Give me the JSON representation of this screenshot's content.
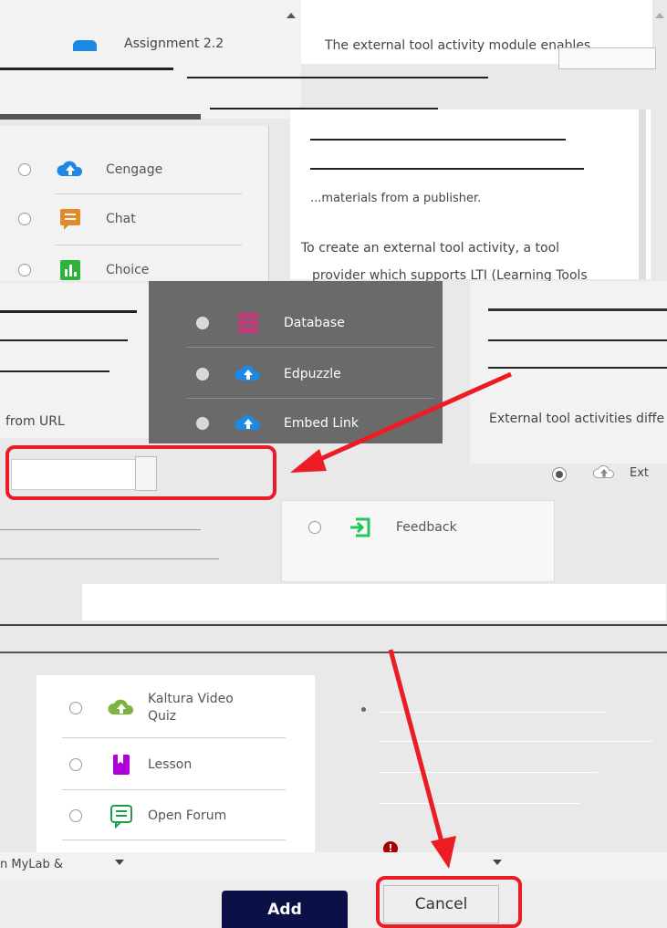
{
  "top": {
    "assignment_label": "Assignment 2.2",
    "description_first_line": "The external tool activity module enables"
  },
  "description": {
    "line_a": "...materials from a publisher.",
    "line_b": "To create an external tool activity, a tool",
    "line_c": "provider which supports LTI (Learning Tools",
    "line_d": "External tool activities diffe"
  },
  "activity_list_left": [
    {
      "label": "Cengage",
      "icon": "cloud-upload-icon",
      "color": "#1e88e5"
    },
    {
      "label": "Chat",
      "icon": "chat-icon",
      "color": "#e08a2c"
    },
    {
      "label": "Choice",
      "icon": "choice-chart-icon",
      "color": "#2fb23a"
    }
  ],
  "activity_list_dark": [
    {
      "label": "Database",
      "icon": "database-icon",
      "color": "#c0377a"
    },
    {
      "label": "Edpuzzle",
      "icon": "cloud-upload-icon",
      "color": "#1e88e5"
    },
    {
      "label": "Embed Link",
      "icon": "cloud-upload-icon",
      "color": "#1e88e5"
    }
  ],
  "activity_list_mid": [
    {
      "label": "Feedback",
      "icon": "feedback-icon",
      "color": "#22c55e"
    }
  ],
  "activity_list_bottom": [
    {
      "label": "Kaltura Video Quiz",
      "line1": "Kaltura Video",
      "line2": "Quiz",
      "icon": "cloud-upload-icon",
      "color": "#7cb342"
    },
    {
      "label": "Lesson",
      "icon": "lesson-icon",
      "color": "#b000d8"
    },
    {
      "label": "Open Forum",
      "icon": "forum-icon",
      "color": "#1e9e4a"
    }
  ],
  "left_fragments": {
    "from_url": "from URL",
    "mylab": "n MyLab &"
  },
  "right_fragments": {
    "external_tool": "Ext"
  },
  "footer": {
    "add_label": "Add",
    "cancel_label": "Cancel"
  },
  "colors": {
    "annotation_red": "#ec1c24",
    "add_button_bg": "#0b1146",
    "cancel_button_bg": "#eeeeee"
  }
}
